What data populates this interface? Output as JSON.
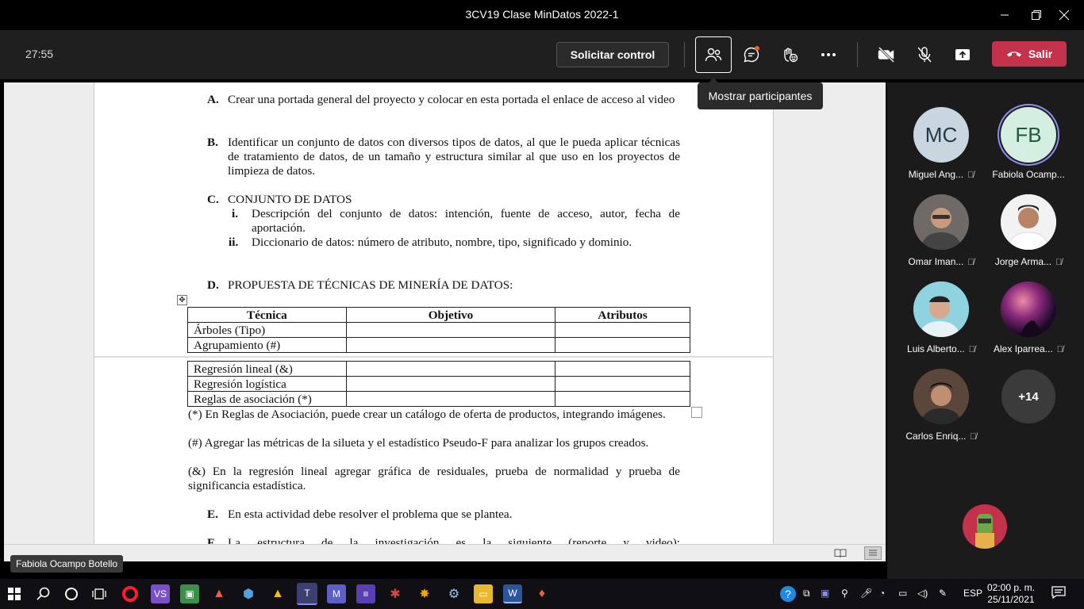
{
  "window": {
    "title": "3CV19 Clase MinDatos 2022-1"
  },
  "controls": {
    "timer": "27:55",
    "request_control": "Solicitar control",
    "leave": "Salir",
    "tooltip": "Mostrar participantes"
  },
  "document": {
    "items": {
      "a_label": "A.",
      "a_text": "Crear una portada general del proyecto y colocar en esta portada el enlace de acceso al video",
      "b_label": "B.",
      "b_text": "Identificar un conjunto de datos con diversos tipos de datos, al que le pueda aplicar técnicas de tratamiento de datos, de un tamaño y estructura similar al que uso en los proyectos de limpieza de datos.",
      "c_label": "C.",
      "c_text": "CONJUNTO DE DATOS",
      "ci_label": "i.",
      "ci_text": "Descripción del conjunto de datos: intención, fuente de acceso, autor, fecha de aportación.",
      "cii_label": "ii.",
      "cii_text": "Diccionario de datos: número de atributo, nombre, tipo, significado y dominio.",
      "d_label": "D.",
      "d_text": "PROPUESTA DE TÉCNICAS DE MINERÍA DE DATOS:",
      "e_label": "E.",
      "e_text": "En esta actividad debe resolver el problema que se plantea.",
      "f_label": "F.",
      "f_text": "La estructura de la investigación es la siguiente (reporte y video):"
    },
    "table": {
      "headers": [
        "Técnica",
        "Objetivo",
        "Atributos"
      ],
      "rows_page1": [
        "Árboles (Tipo)",
        "Agrupamiento (#)"
      ],
      "rows_page2": [
        "Regresión lineal (&)",
        "Regresión logística",
        "Reglas de asociación (*)"
      ]
    },
    "notes": {
      "n1": "(*) En Reglas de Asociación, puede crear un catálogo de oferta de productos, integrando imágenes.",
      "n2": "(#) Agregar las métricas de la silueta y el estadístico Pseudo-F para analizar los grupos creados.",
      "n3": "(&) En la regresión lineal agregar gráfica de residuales, prueba de normalidad y prueba de significancia estadística."
    }
  },
  "presenter_name": "Fabiola Ocampo Botello",
  "participants": [
    {
      "initials": "MC",
      "name": "Miguel Ang...",
      "bg": "#c9d6df",
      "fg": "#1f3a4d"
    },
    {
      "initials": "FB",
      "name": "Fabiola Ocamp...",
      "bg": "#d4eee0",
      "fg": "#1f5a3c"
    },
    {
      "initials": "",
      "name": "Omar Iman...",
      "bg": "#6f6a66",
      "fg": "#fff"
    },
    {
      "initials": "",
      "name": "Jorge Arma...",
      "bg": "#e8e2dc",
      "fg": "#fff"
    },
    {
      "initials": "",
      "name": "Luis Alberto...",
      "bg": "#7fc8d8",
      "fg": "#fff"
    },
    {
      "initials": "",
      "name": "Alex Iparrea...",
      "bg": "#5a1e5e",
      "fg": "#fff"
    },
    {
      "initials": "",
      "name": "Carlos Enriq...",
      "bg": "#4d3a30",
      "fg": "#fff"
    }
  ],
  "more_participants": "+14",
  "taskbar": {
    "lang": "ESP",
    "time": "02:00 p. m.",
    "date": "25/11/2021"
  }
}
